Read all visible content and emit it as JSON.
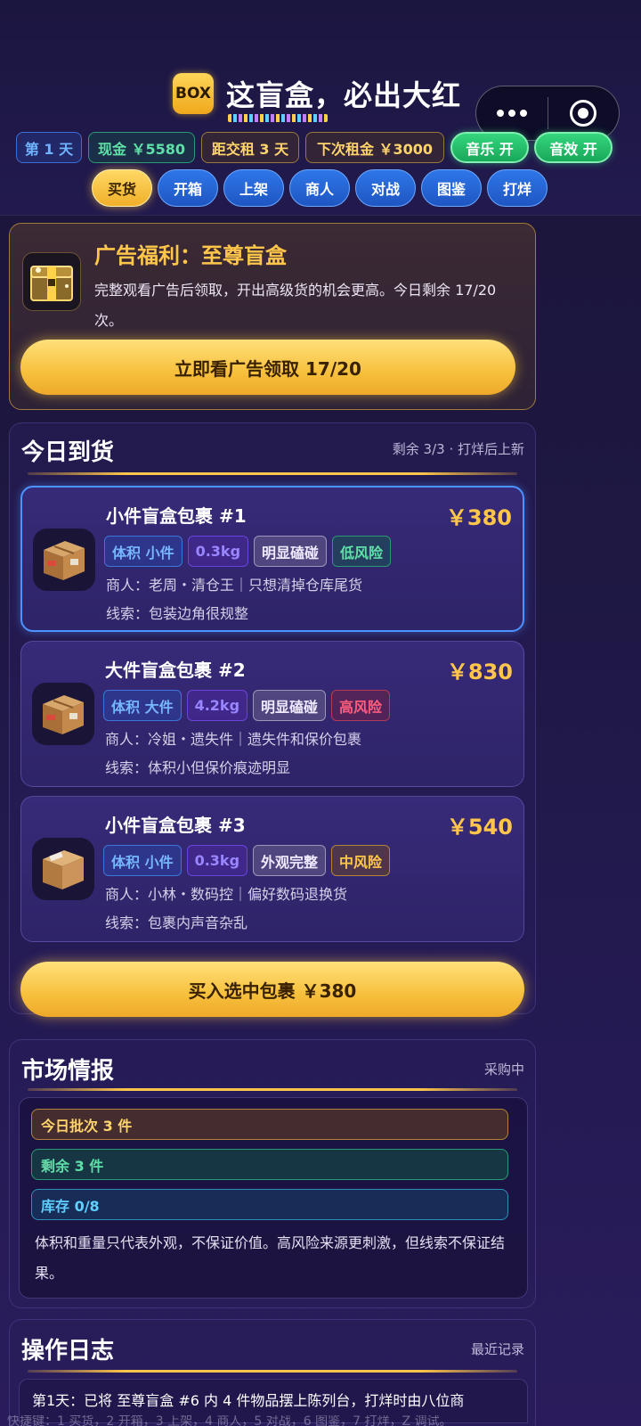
{
  "header": {
    "logo_text": "BOX",
    "title": "这盲盒，必出大红",
    "stats": {
      "day": "第 1 天",
      "cash": "现金 ￥5580",
      "rent_due": "距交租 3 天",
      "next_rent": "下次租金 ￥3000"
    },
    "music_toggle": "音乐 开",
    "sfx_toggle": "音效 开",
    "tabs": [
      "买货",
      "开箱",
      "上架",
      "商人",
      "对战",
      "图鉴",
      "打烊"
    ],
    "active_tab": "买货"
  },
  "ad": {
    "title": "广告福利：至尊盲盒",
    "description": "完整观看广告后领取，开出高级货的机会更高。今日剩余 17/20 次。",
    "button": "立即看广告领取 17/20"
  },
  "today": {
    "title": "今日到货",
    "subtitle": "剩余 3/3 · 打烊后上新",
    "items": [
      {
        "name": "小件盲盒包裹 #1",
        "price": "￥380",
        "size": "体积 小件",
        "weight": "0.3kg",
        "condition": "明显磕碰",
        "risk": "低风险",
        "merchant": "商人：老周・清仓王｜只想清掉仓库尾货",
        "clue": "线索：包装边角很规整",
        "selected": true
      },
      {
        "name": "大件盲盒包裹 #2",
        "price": "￥830",
        "size": "体积 大件",
        "weight": "4.2kg",
        "condition": "明显磕碰",
        "risk": "高风险",
        "merchant": "商人：冷姐・遗失件｜遗失件和保价包裹",
        "clue": "线索：体积小但保价痕迹明显",
        "selected": false
      },
      {
        "name": "小件盲盒包裹 #3",
        "price": "￥540",
        "size": "体积 小件",
        "weight": "0.3kg",
        "condition": "外观完整",
        "risk": "中风险",
        "merchant": "商人：小林・数码控｜偏好数码退换货",
        "clue": "线索：包裹内声音杂乱",
        "selected": false
      }
    ],
    "buy_button": "买入选中包裹 ￥380"
  },
  "market": {
    "title": "市场情报",
    "status": "采购中",
    "batch": "今日批次 3 件",
    "remaining": "剩余 3 件",
    "stock": "库存 0/8",
    "note": "体积和重量只代表外观，不保证价值。高风险来源更刺激，但线索不保证结果。"
  },
  "log": {
    "title": "操作日志",
    "subtitle": "最近记录",
    "entry": "第1天：已将 至尊盲盒 #6 内 4 件物品摆上陈列台，打烊时由八位商"
  },
  "hint": "快捷键：1 买货，2 开箱，3 上架，4 商人，5 对战，6 图鉴，7 打烊，Z 调试。",
  "colors": {
    "accent_gold": "#ffc64a",
    "selected_blue": "#4d93ff",
    "toggle_green": "#35d67e",
    "tab_blue": "#2f76e8"
  },
  "icons": {
    "capsule_more": "more-dots-icon",
    "capsule_close": "target-icon",
    "ad": "golden-treasure-box-icon",
    "item": "cardboard-box-icon"
  }
}
